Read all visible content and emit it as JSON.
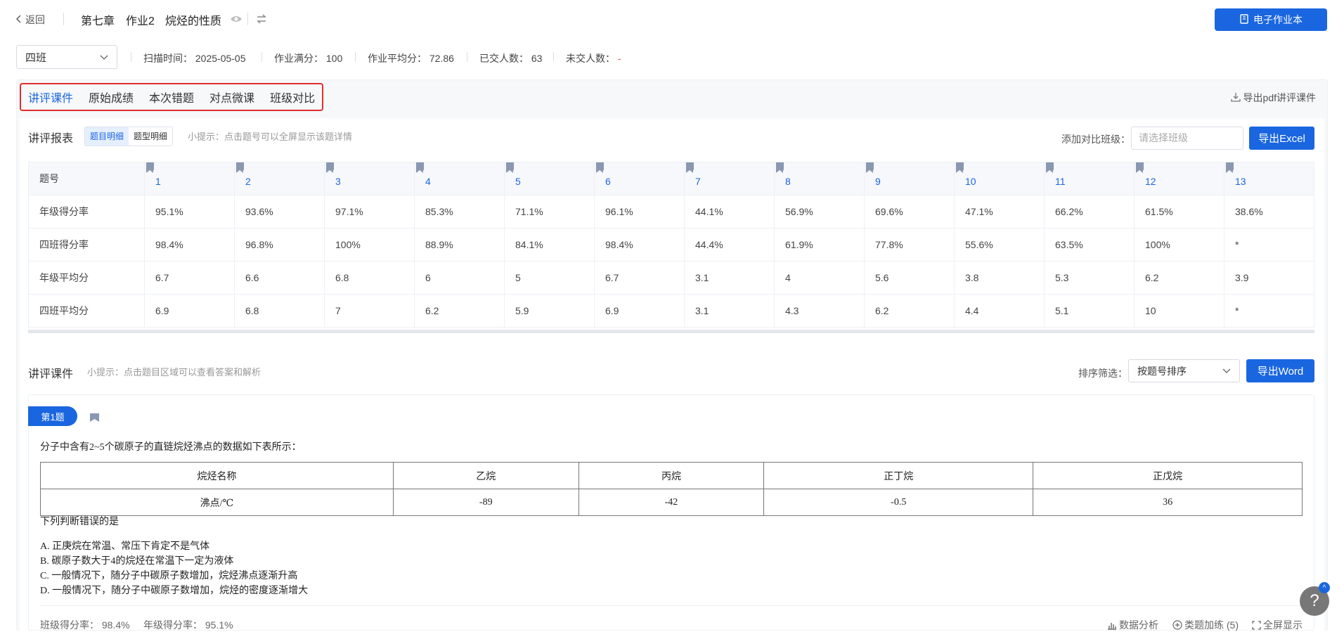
{
  "header": {
    "back_label": "返回",
    "chapter": "第七章",
    "assignment": "作业2",
    "topic": "烷烃的性质",
    "ebook_label": "电子作业本"
  },
  "filters": {
    "class_select": "四班",
    "scan_time_label": "扫描时间：",
    "scan_time": "2025-05-05",
    "full_score_label": "作业满分：",
    "full_score": "100",
    "avg_score_label": "作业平均分：",
    "avg_score": "72.86",
    "submitted_label": "已交人数：",
    "submitted": "63",
    "unsubmitted_label": "未交人数：",
    "unsubmitted": "-"
  },
  "tabs": [
    "讲评课件",
    "原始成绩",
    "本次错题",
    "对点微课",
    "班级对比"
  ],
  "export_pdf_label": "导出pdf讲评课件",
  "report": {
    "title": "讲评报表",
    "toggle": [
      "题目明细",
      "题型明细"
    ],
    "tip": "小提示：点击题号可以全屏显示该题详情",
    "compare_label": "添加对比班级：",
    "compare_placeholder": "请选择班级",
    "export_excel": "导出Excel"
  },
  "score_table": {
    "header": "题号",
    "questions": [
      "1",
      "2",
      "3",
      "4",
      "5",
      "6",
      "7",
      "8",
      "9",
      "10",
      "11",
      "12",
      "13"
    ],
    "rows": [
      {
        "label": "年级得分率",
        "values": [
          "95.1%",
          "93.6%",
          "97.1%",
          "85.3%",
          "71.1%",
          "96.1%",
          "44.1%",
          "56.9%",
          "69.6%",
          "47.1%",
          "66.2%",
          "61.5%",
          "38.6%"
        ]
      },
      {
        "label": "四班得分率",
        "values": [
          "98.4%",
          "96.8%",
          "100%",
          "88.9%",
          "84.1%",
          "98.4%",
          "44.4%",
          "61.9%",
          "77.8%",
          "55.6%",
          "63.5%",
          "100%",
          "*"
        ]
      },
      {
        "label": "年级平均分",
        "values": [
          "6.7",
          "6.6",
          "6.8",
          "6",
          "5",
          "6.7",
          "3.1",
          "4",
          "5.6",
          "3.8",
          "5.3",
          "6.2",
          "3.9"
        ]
      },
      {
        "label": "四班平均分",
        "values": [
          "6.9",
          "6.8",
          "7",
          "6.2",
          "5.9",
          "6.9",
          "3.1",
          "4.3",
          "6.2",
          "4.4",
          "5.1",
          "10",
          "*"
        ]
      }
    ],
    "highlight_color": "#e64545"
  },
  "courseware": {
    "title": "讲评课件",
    "tip": "小提示：点击题目区域可以查看答案和解析",
    "sort_label": "排序筛选：",
    "sort_value": "按题号排序",
    "export_word": "导出Word"
  },
  "question": {
    "badge": "第1题",
    "stem": "分子中含有2~5个碳原子的直链烷烃沸点的数据如下表所示：",
    "table_header": [
      "烷烃名称",
      "乙烷",
      "丙烷",
      "正丁烷",
      "正戊烷"
    ],
    "table_row": [
      "沸点/℃",
      "-89",
      "-42",
      "-0.5",
      "36"
    ],
    "prompt": "下列判断错误的是",
    "options": [
      "A. 正庚烷在常温、常压下肯定不是气体",
      "B. 碳原子数大于4的烷烃在常温下一定为液体",
      "C. 一般情况下，随分子中碳原子数增加，烷烃沸点逐渐升高",
      "D. 一般情况下，随分子中碳原子数增加，烷烃的密度逐渐增大"
    ],
    "class_rate_label": "班级得分率：",
    "class_rate": "98.4%",
    "grade_rate_label": "年级得分率：",
    "grade_rate": "95.1%",
    "data_analysis": "数据分析",
    "similar_practice": "类题加练 (5)",
    "fullscreen": "全屏显示"
  },
  "help": {
    "symbol": "?",
    "badge": "^"
  }
}
